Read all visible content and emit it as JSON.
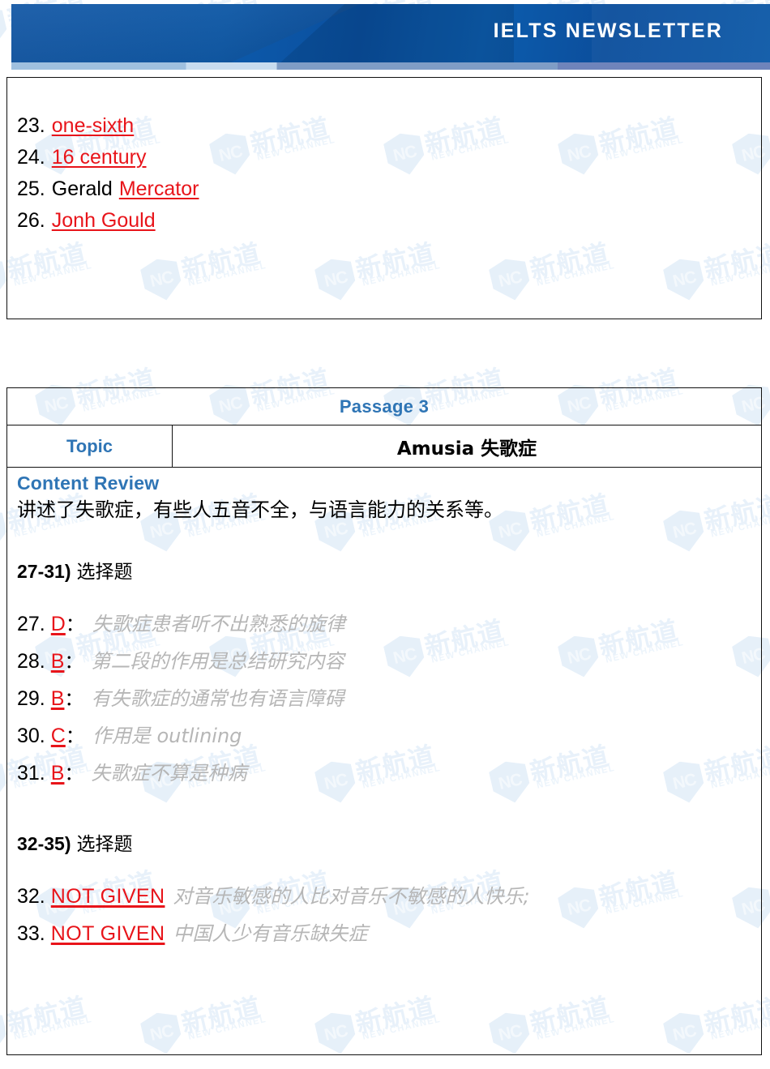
{
  "header": {
    "logo": {
      "shield_text": "NC",
      "chinese_name": "新航道",
      "english_name": "NEW CHANNEL",
      "registered_mark": "®",
      "icon": "shield-logo-icon"
    },
    "title": "IELTS  NEWSLETTER",
    "banner_color": "#0d55a2",
    "strip_colors": [
      "#9fc0df",
      "#c8dcef",
      "#7f9dc6",
      "#6f84bb"
    ]
  },
  "watermark": {
    "shield_text": "NC",
    "chinese_name": "新航道",
    "english_name": "NEW CHANNEL",
    "color": "#d2e4f6"
  },
  "answers_box": {
    "items": [
      {
        "number": "23.",
        "plain": "",
        "answer": "one-sixth"
      },
      {
        "number": "24.",
        "plain": "",
        "answer": "16 century"
      },
      {
        "number": "25.",
        "plain": "Gerald",
        "answer": "Mercator"
      },
      {
        "number": "26.",
        "plain": "",
        "answer": "Jonh Gould   "
      }
    ],
    "answer_color": "#e8141a"
  },
  "passage": {
    "title": "Passage 3",
    "title_color": "#2f75b5",
    "topic_label": "Topic",
    "topic_value": "Amusia 失歌症",
    "content_review_heading": "Content Review",
    "content_review_summary": "讲述了失歌症，有些人五音不全，与语言能力的关系等。",
    "sections": [
      {
        "range": "27-31)",
        "type_label": "选择题",
        "questions": [
          {
            "number": "27.",
            "answer": "D",
            "colon": "：",
            "desc": "失歌症患者听不出熟悉的旋律",
            "desc_lang": "cn"
          },
          {
            "number": "28.",
            "answer": "B",
            "colon": "：",
            "desc": "第二段的作用是总结研究内容",
            "desc_lang": "cn"
          },
          {
            "number": "29.",
            "answer": "B",
            "colon": "：",
            "desc": "有失歌症的通常也有语言障碍",
            "desc_lang": "cn"
          },
          {
            "number": "30.",
            "answer": "C",
            "colon": "：",
            "desc": "作用是 outlining",
            "desc_lang": "cn"
          },
          {
            "number": "31.",
            "answer": "B",
            "colon": "：",
            "desc": "失歌症不算是种病",
            "desc_lang": "cn"
          }
        ]
      },
      {
        "range": "32-35)",
        "type_label": "选择题",
        "questions": [
          {
            "number": "32.",
            "answer": "NOT GIVEN ",
            "colon": "",
            "desc": "对音乐敏感的人比对音乐不敏感的人快乐;",
            "desc_lang": "cn"
          },
          {
            "number": "33.",
            "answer": "NOT GIVEN",
            "colon": "",
            "desc": "中国人少有音乐缺失症",
            "desc_lang": "cn"
          }
        ]
      }
    ]
  }
}
